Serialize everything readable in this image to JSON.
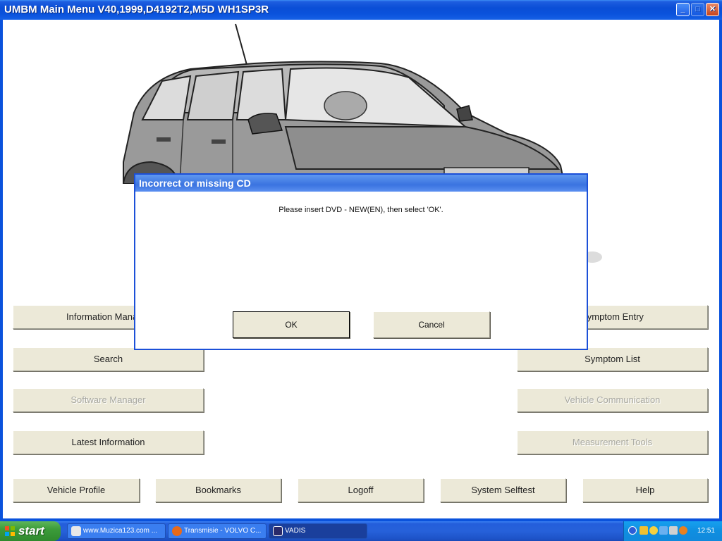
{
  "window": {
    "title": "UMBM Main Menu V40,1999,D4192T2,M5D WH1SP3R"
  },
  "menu": {
    "information_manager": "Information Manager",
    "symptom_entry": "Symptom Entry",
    "search": "Search",
    "symptom_list": "Symptom List",
    "software_manager": "Software Manager",
    "vehicle_communication": "Vehicle Communication",
    "latest_information": "Latest Information",
    "measurement_tools": "Measurement Tools",
    "vehicle_profile": "Vehicle Profile",
    "bookmarks": "Bookmarks",
    "logoff": "Logoff",
    "system_selftest": "System Selftest",
    "help": "Help"
  },
  "dialog": {
    "title": "Incorrect or missing CD",
    "message": "Please insert DVD - NEW(EN), then select 'OK'.",
    "ok_label": "OK",
    "cancel_label": "Cancel"
  },
  "taskbar": {
    "start_label": "start",
    "tasks": [
      {
        "label": "www.Muzica123.com ..."
      },
      {
        "label": "Transmisie - VOLVO C..."
      },
      {
        "label": "VADIS"
      }
    ],
    "clock": "12:51"
  },
  "colors": {
    "titlebar": "#0a52dc",
    "button_face": "#ece9d8",
    "taskbar": "#245edb",
    "start_button": "#3c9c3a"
  }
}
